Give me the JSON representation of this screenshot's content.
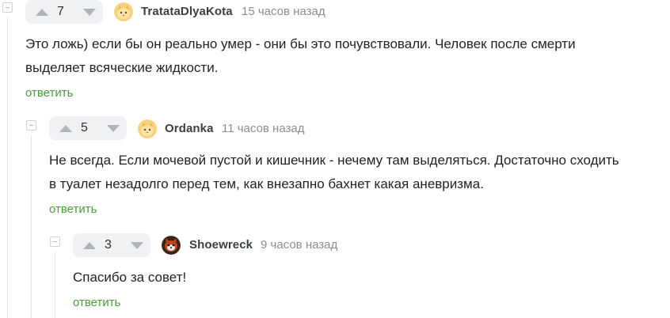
{
  "comments": [
    {
      "score": "7",
      "author": "TratataDlyaKota",
      "time": "15 часов назад",
      "text": [
        "Это ложь) если бы он реально умер - они бы это почувствовали. Человек после смерти",
        "выделяет всяческие жидкости."
      ],
      "reply": "ответить",
      "avatar_icon": "cat-avatar-icon"
    },
    {
      "score": "5",
      "author": "Ordanka",
      "time": "11 часов назад",
      "text": [
        "Не всегда. Если мочевой пустой и кишечник - нечему там выделяться. Достаточно сходить",
        "в туалет незадолго перед тем, как внезапно бахнет какая аневризма."
      ],
      "reply": "ответить",
      "avatar_icon": "cat-avatar-icon"
    },
    {
      "score": "3",
      "author": "Shoewreck",
      "time": "9 часов назад",
      "text": [
        "Спасибо за совет!"
      ],
      "reply": "ответить",
      "avatar_icon": "red-panda-avatar-icon"
    }
  ],
  "colors": {
    "reply_green": "#4a9d38",
    "vote_bg": "#f0f1f3",
    "thread_line": "#e3e5e8"
  }
}
